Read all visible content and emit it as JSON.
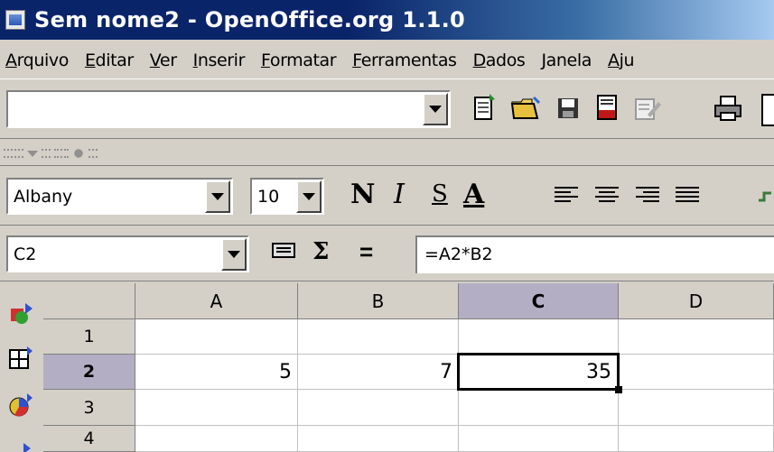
{
  "window": {
    "title": "Sem nome2 - OpenOffice.org 1.1.0"
  },
  "menu": [
    {
      "label": "Arquivo",
      "accel": "A",
      "rest": "rquivo"
    },
    {
      "label": "Editar",
      "accel": "E",
      "rest": "ditar"
    },
    {
      "label": "Ver",
      "accel": "V",
      "rest": "er"
    },
    {
      "label": "Inserir",
      "accel": "I",
      "rest": "nserir"
    },
    {
      "label": "Formatar",
      "accel": "F",
      "rest": "ormatar"
    },
    {
      "label": "Ferramentas",
      "accel": "F",
      "rest": "erramentas"
    },
    {
      "label": "Dados",
      "accel": "D",
      "rest": "ados"
    },
    {
      "label": "Janela",
      "accel": "J",
      "rest": "anela"
    },
    {
      "label": "Aju",
      "accel": "A",
      "rest": "ju"
    }
  ],
  "toolbar": {
    "url_value": "",
    "icons": [
      "new-document-icon",
      "open-folder-icon",
      "save-icon",
      "export-pdf-icon",
      "edit-file-icon",
      "print-icon"
    ]
  },
  "format_bar": {
    "font_name": "Albany",
    "font_size": "10",
    "bold_label": "N",
    "italic_label": "I",
    "underline_label": "S",
    "font_color_label": "A"
  },
  "formula_bar": {
    "name_box": "C2",
    "sum_symbol": "Σ",
    "equals_symbol": "=",
    "formula": "=A2*B2"
  },
  "sheet": {
    "columns": [
      "A",
      "B",
      "C",
      "D"
    ],
    "selected_column": "C",
    "rows": [
      "1",
      "2",
      "3",
      "4"
    ],
    "selected_row": "2",
    "cells": {
      "A2": "5",
      "B2": "7",
      "C2": "35"
    },
    "active_cell": "C2"
  }
}
